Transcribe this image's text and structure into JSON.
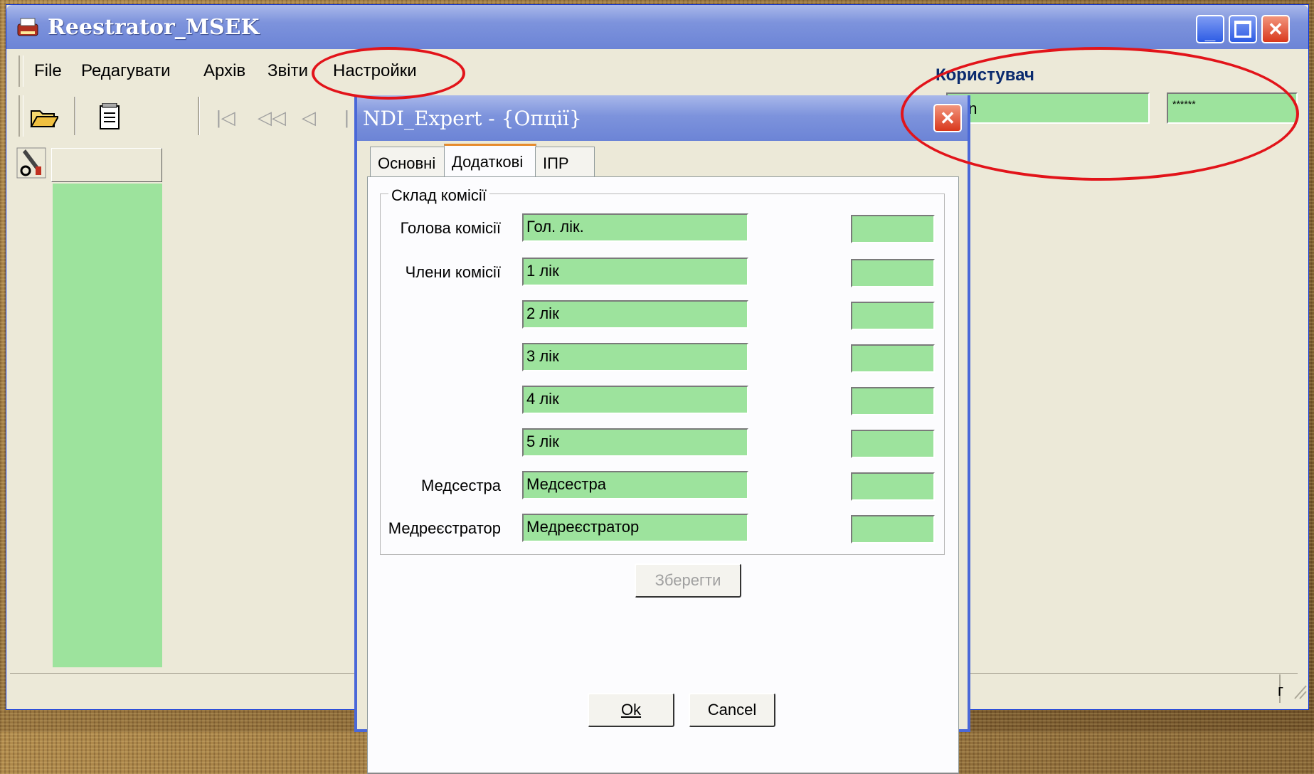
{
  "main_window": {
    "title": "Reestrator_MSEK",
    "menu": [
      "File",
      "Редагувати",
      "Архів",
      "Звіти",
      "Настройки"
    ],
    "user_label": "Користувач",
    "user_value": "min",
    "password_value": "******",
    "status_text": "г"
  },
  "dialog": {
    "title": "NDI_Expert - {Опції}",
    "tabs": [
      "Основні",
      "Додаткові",
      "ІПР"
    ],
    "group_title": "Склад комісії",
    "rows": [
      {
        "label": "Голова комісії",
        "value": "Гол. лік."
      },
      {
        "label": "Члени комісії",
        "value": "1 лік"
      },
      {
        "label": "",
        "value": "2 лік"
      },
      {
        "label": "",
        "value": "3 лік"
      },
      {
        "label": "",
        "value": "4 лік"
      },
      {
        "label": "",
        "value": "5 лік"
      },
      {
        "label": "Медсестра",
        "value": "Медсестра"
      },
      {
        "label": "Медреєстратор",
        "value": "Медреєстратор"
      }
    ],
    "save_label": "Зберегти",
    "ok_label": "Ok",
    "cancel_label": "Cancel"
  },
  "colors": {
    "field_green": "#9de39d",
    "titlebar_blue": "#7d93dc",
    "annotation_red": "#e2141a"
  },
  "icons": [
    "app-icon",
    "open-folder-icon",
    "notepad-icon",
    "first-record-icon",
    "prev-page-icon",
    "prev-record-icon",
    "tools-icon",
    "close-icon",
    "minimize-icon",
    "maximize-icon"
  ]
}
